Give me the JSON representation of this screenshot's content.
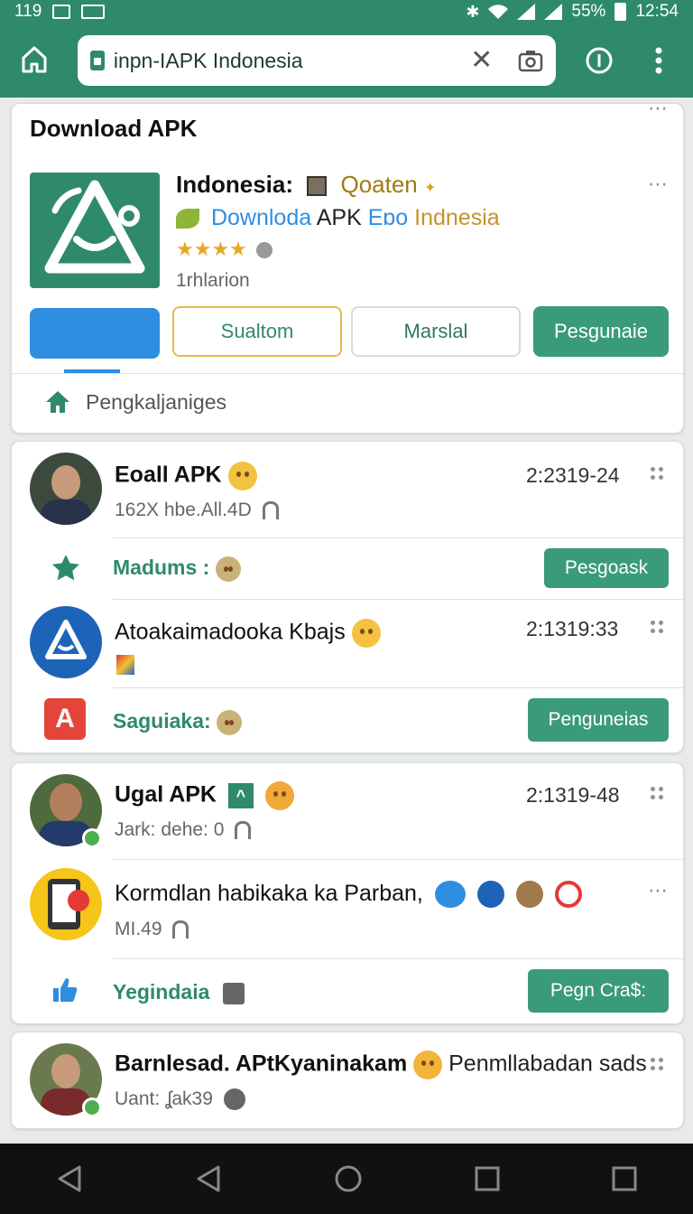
{
  "status": {
    "time_left": "119",
    "battery": "55%",
    "clock": "12:54"
  },
  "browser": {
    "url": "inpn-IAPK Indonesia"
  },
  "download_card": {
    "header": "Download APK",
    "title": "Indonesia:",
    "title_extra": "Qoaten",
    "subtitle_a": "Downloda",
    "subtitle_b": "APK",
    "subtitle_c": "Eɒo",
    "subtitle_d": "Indnesia",
    "stars": "★★★★",
    "sub_label": "1rhlarion",
    "buttons": [
      "",
      "Sualtom",
      "Marslal",
      "Pesgunaie"
    ],
    "footer_label": "Pengkaljaniges"
  },
  "chat1": {
    "name": "Eoall APK",
    "time": "2:2319-24",
    "sub": "162X hbe.All.4D",
    "row1_label": "Madums :",
    "row1_button": "Pesgoask",
    "entry2_name": "Atoakaimadooka Kbajs",
    "entry2_time": "2:1319:33",
    "row2_label": "Saguiaka:",
    "row2_button": "Penguneias"
  },
  "chat2": {
    "name": "Ugal APK",
    "time": "2:1319-48",
    "sub": "Jark: dehe: 0",
    "entry2_name": "Kormdlan habikaka ka Parban,",
    "entry2_sub": "MI.49",
    "row_label": "Yegindaia",
    "row_button": "Pegn Cra$:"
  },
  "chat3": {
    "name": "Barnlesad. APtKyaninakam",
    "name_tail": "Penmllabadan sads",
    "sub": "Uant: ʆak39"
  },
  "colors": {
    "brand": "#2f8a6c",
    "blue": "#2f8ee0",
    "yellow_border": "#e8b84a"
  }
}
